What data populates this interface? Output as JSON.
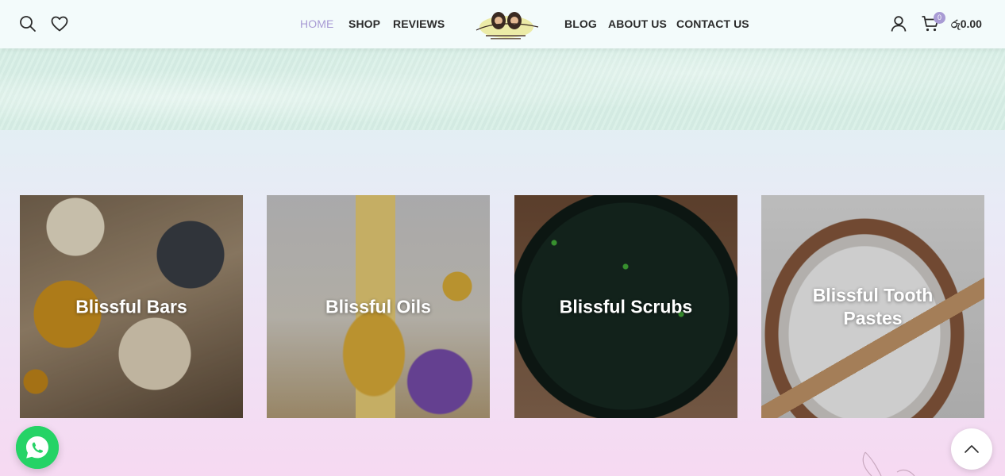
{
  "header": {
    "nav_left": [
      {
        "label": "HOME",
        "active": true
      },
      {
        "label": "SHOP",
        "active": false
      },
      {
        "label": "REVIEWS",
        "active": false
      }
    ],
    "nav_right": [
      {
        "label": "BLOG"
      },
      {
        "label": "ABOUT US"
      },
      {
        "label": "CONTACT US"
      }
    ],
    "cart": {
      "count": "0",
      "total": "රු0.00"
    },
    "icons": [
      "search-icon",
      "heart-icon",
      "user-icon",
      "cart-icon"
    ],
    "accent_color": "#a89bd4"
  },
  "categories": [
    {
      "label": "Blissful Bars"
    },
    {
      "label": "Blissful Oils"
    },
    {
      "label": "Blissful Scrubs"
    },
    {
      "label": "Blissful Tooth Pastes"
    }
  ],
  "floating": {
    "whatsapp_icon": "whatsapp-icon",
    "scroll_top_icon": "chevron-up-icon",
    "whatsapp_color": "#25d366"
  }
}
